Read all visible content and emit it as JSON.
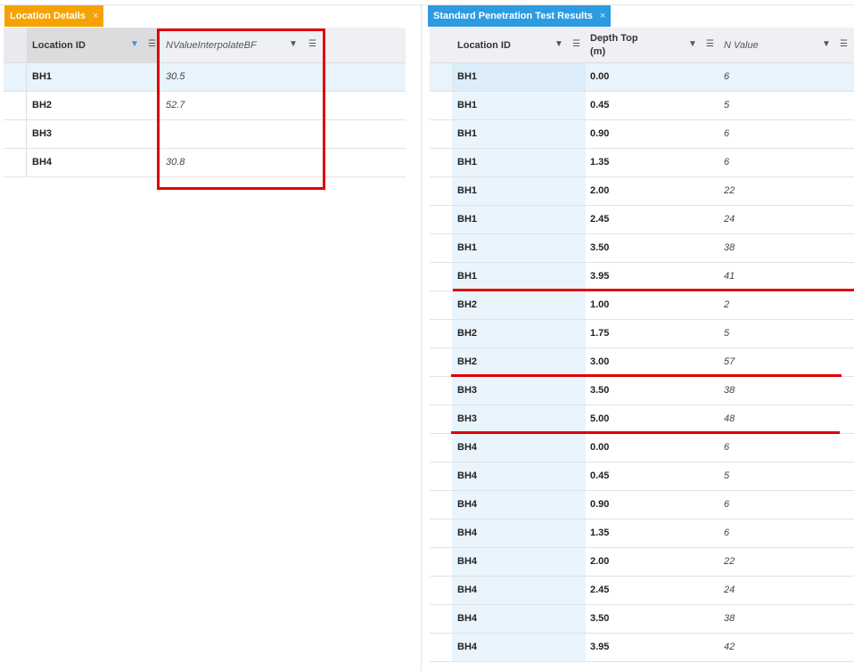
{
  "left": {
    "tab": {
      "label": "Location Details",
      "close": "×",
      "color": "#f5a300"
    },
    "columns": [
      "Location ID",
      "NValueInterpolateBF"
    ],
    "rows": [
      {
        "id": "BH1",
        "n": "30.5"
      },
      {
        "id": "BH2",
        "n": "52.7"
      },
      {
        "id": "BH3",
        "n": ""
      },
      {
        "id": "BH4",
        "n": "30.8"
      }
    ]
  },
  "right": {
    "tab": {
      "label": "Standard Penetration Test Results",
      "close": "×",
      "color": "#2c9be0"
    },
    "columns": [
      "Location ID",
      "Depth Top (m)",
      "N Value"
    ],
    "rows": [
      [
        "BH1",
        "0.00",
        "6"
      ],
      [
        "BH1",
        "0.45",
        "5"
      ],
      [
        "BH1",
        "0.90",
        "6"
      ],
      [
        "BH1",
        "1.35",
        "6"
      ],
      [
        "BH1",
        "2.00",
        "22"
      ],
      [
        "BH1",
        "2.45",
        "24"
      ],
      [
        "BH1",
        "3.50",
        "38"
      ],
      [
        "BH1",
        "3.95",
        "41"
      ],
      [
        "BH2",
        "1.00",
        "2"
      ],
      [
        "BH2",
        "1.75",
        "5"
      ],
      [
        "BH2",
        "3.00",
        "57"
      ],
      [
        "BH3",
        "3.50",
        "38"
      ],
      [
        "BH3",
        "5.00",
        "48"
      ],
      [
        "BH4",
        "0.00",
        "6"
      ],
      [
        "BH4",
        "0.45",
        "5"
      ],
      [
        "BH4",
        "0.90",
        "6"
      ],
      [
        "BH4",
        "1.35",
        "6"
      ],
      [
        "BH4",
        "2.00",
        "22"
      ],
      [
        "BH4",
        "2.45",
        "24"
      ],
      [
        "BH4",
        "3.50",
        "38"
      ],
      [
        "BH4",
        "3.95",
        "42"
      ]
    ]
  },
  "icons": {
    "filter": "filter-icon",
    "columns": "column-menu-icon"
  }
}
